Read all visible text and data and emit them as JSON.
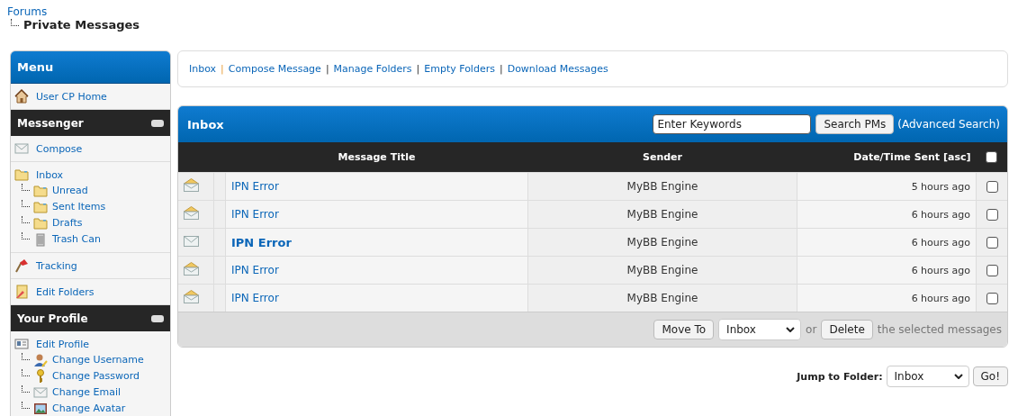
{
  "breadcrumb": {
    "root": "Forums",
    "current": "Private Messages"
  },
  "sidebar": {
    "title": "Menu",
    "groups": [
      {
        "kind": "links",
        "items": [
          {
            "label": "User CP Home"
          }
        ]
      },
      {
        "kind": "header",
        "title": "Messenger",
        "expanded": true
      },
      {
        "kind": "links",
        "items": [
          {
            "label": "Compose"
          }
        ]
      },
      {
        "kind": "links",
        "items": [
          {
            "label": "Inbox",
            "children": [
              {
                "label": "Unread"
              },
              {
                "label": "Sent Items"
              },
              {
                "label": "Drafts"
              },
              {
                "label": "Trash Can"
              }
            ]
          }
        ]
      },
      {
        "kind": "links",
        "items": [
          {
            "label": "Tracking"
          }
        ]
      },
      {
        "kind": "links",
        "items": [
          {
            "label": "Edit Folders"
          }
        ]
      },
      {
        "kind": "header",
        "title": "Your Profile",
        "expanded": true
      },
      {
        "kind": "links",
        "items": [
          {
            "label": "Edit Profile",
            "children": [
              {
                "label": "Change Username"
              },
              {
                "label": "Change Password"
              },
              {
                "label": "Change Email"
              },
              {
                "label": "Change Avatar"
              }
            ]
          }
        ]
      }
    ]
  },
  "nav": {
    "separator": "|",
    "links": [
      "Inbox",
      "Compose Message",
      "Manage Folders",
      "Empty Folders",
      "Download Messages"
    ]
  },
  "inbox": {
    "title": "Inbox",
    "search": {
      "placeholder": "Enter Keywords",
      "button": "Search PMs",
      "advanced": "(Advanced Search)"
    },
    "columns": [
      "Message Title",
      "Sender",
      "Date/Time Sent [asc]"
    ],
    "select_all": {
      "checked": false
    },
    "rows": [
      {
        "title": "IPN Error",
        "sender": "MyBB Engine",
        "sent": "5 hours ago",
        "unread": false,
        "checked": false
      },
      {
        "title": "IPN Error",
        "sender": "MyBB Engine",
        "sent": "6 hours ago",
        "unread": false,
        "checked": false
      },
      {
        "title": "IPN Error",
        "sender": "MyBB Engine",
        "sent": "6 hours ago",
        "unread": true,
        "checked": false
      },
      {
        "title": "IPN Error",
        "sender": "MyBB Engine",
        "sent": "6 hours ago",
        "unread": false,
        "checked": false
      },
      {
        "title": "IPN Error",
        "sender": "MyBB Engine",
        "sent": "6 hours ago",
        "unread": false,
        "checked": false
      }
    ],
    "footer": {
      "move_button": "Move To",
      "move_folder": "Inbox",
      "or": "or",
      "delete_button": "Delete",
      "suffix": "the selected messages"
    }
  },
  "jump": {
    "label": "Jump to Folder:",
    "folder": "Inbox",
    "button": "Go!"
  }
}
